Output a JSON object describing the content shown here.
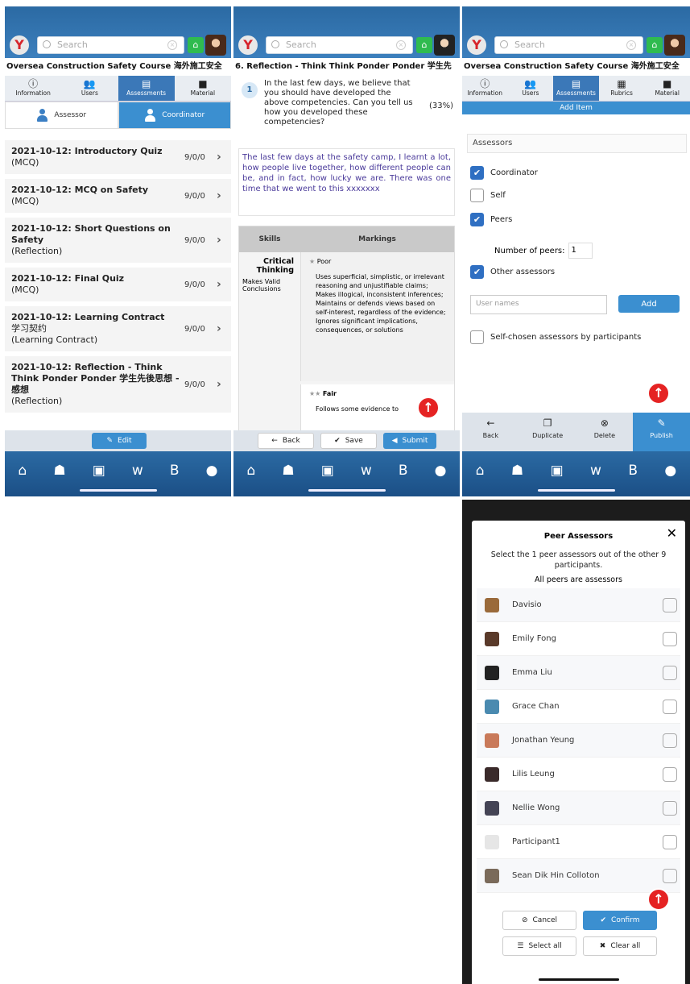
{
  "app": {
    "search_placeholder": "Search",
    "course_title": "Oversea Construction Safety Course 海外施工安全",
    "logo_letter": "Y"
  },
  "tabs": [
    "Information",
    "Users",
    "Assessments",
    "Material"
  ],
  "tabs3": [
    "Information",
    "Users",
    "Assessments",
    "Rubrics",
    "Material"
  ],
  "subtabs": [
    "Assessor",
    "Coordinator"
  ],
  "assessments": [
    {
      "title": "2021-10-12: Introductory Quiz",
      "type": "(MCQ)",
      "count": "9/0/0"
    },
    {
      "title": "2021-10-12: MCQ on Safety",
      "type": "(MCQ)",
      "count": "9/0/0"
    },
    {
      "title": "2021-10-12: Short Questions on Safety",
      "type": "(Reflection)",
      "count": "9/0/0"
    },
    {
      "title": "2021-10-12: Final Quiz",
      "type": "(MCQ)",
      "count": "9/0/0"
    },
    {
      "title": "2021-10-12: Learning Contract",
      "subtitle": "学习契约",
      "type": "(Learning Contract)",
      "count": "9/0/0"
    },
    {
      "title": "2021-10-12: Reflection - Think Think Ponder Ponder 学生先後思想 - 感想",
      "type": "(Reflection)",
      "count": "9/0/0"
    }
  ],
  "edit_label": "Edit",
  "reflection": {
    "title": "6. Reflection - Think Think Ponder Ponder 学生先",
    "qnum": "1",
    "question": "In the last few days, we believe that you should have developed the above competencies. Can you tell us how you developed these competencies?",
    "percent": "(33%)",
    "answer": "The last few days at the safety camp, I learnt a lot, how people live together, how different people can be, and in fact, how lucky we are. There was one time that we went to this xxxxxxx",
    "col_skills": "Skills",
    "col_markings": "Markings",
    "skill_name": "Critical Thinking",
    "skill_sub": "Makes Valid Conclusions",
    "level1": "Poor",
    "level1_text": "Uses superficial, simplistic, or irrelevant reasoning and unjustifiable claims; Makes illogical, inconsistent inferences; Maintains or defends views based on self-interest, regardless of the evidence; Ignores significant implications, consequences, or solutions",
    "level2": "Fair",
    "level2_text": "Follows some evidence to",
    "back": "Back",
    "save": "Save",
    "submit": "Submit"
  },
  "settings": {
    "add_item": "Add Item",
    "assessors_header": "Assessors",
    "coordinator": "Coordinator",
    "self": "Self",
    "peers": "Peers",
    "num_peers_label": "Number of peers:",
    "num_peers": "1",
    "other_assessors": "Other assessors",
    "user_names_placeholder": "User names",
    "add": "Add",
    "self_chosen": "Self-chosen assessors by participants",
    "toolbar": [
      "Back",
      "Duplicate",
      "Delete",
      "Publish"
    ]
  },
  "modal": {
    "title": "Peer Assessors",
    "desc": "Select the 1 peer assessors out of the other 9 participants.",
    "note": "All peers are assessors",
    "participants": [
      "Davisio",
      "Emily Fong",
      "Emma Liu",
      "Grace Chan",
      "Jonathan Yeung",
      "Lilis Leung",
      "Nellie Wong",
      "Participant1",
      "Sean Dik Hin Colloton"
    ],
    "cancel": "Cancel",
    "confirm": "Confirm",
    "select_all": "Select all",
    "clear_all": "Clear all"
  },
  "colors": {
    "primary": "#3b78b8",
    "accent": "#3b8fd0",
    "fab": "#e52323",
    "home": "#2fbb4f"
  }
}
